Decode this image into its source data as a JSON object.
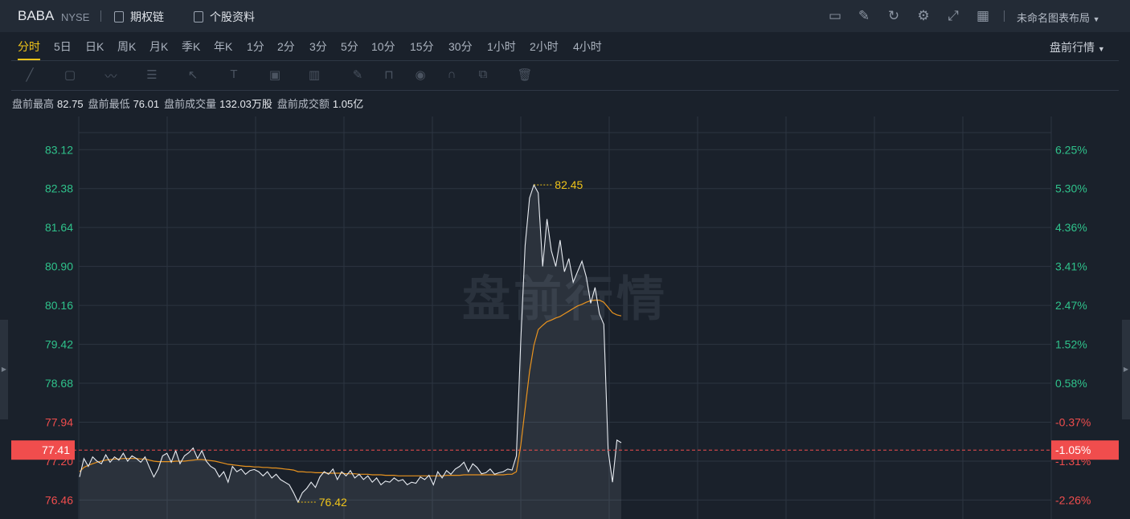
{
  "header": {
    "symbol": "BABA",
    "exchange": "NYSE",
    "options_chain": "期权链",
    "stock_profile": "个股资料",
    "layout_name": "未命名图表布局",
    "icons": [
      "monitor-icon",
      "pencil-icon",
      "refresh-icon",
      "gear-icon",
      "fullscreen-icon",
      "grid-icon"
    ]
  },
  "periods": [
    "分时",
    "5日",
    "日K",
    "周K",
    "月K",
    "季K",
    "年K",
    "1分",
    "2分",
    "3分",
    "5分",
    "10分",
    "15分",
    "30分",
    "1小时",
    "2小时",
    "4小时"
  ],
  "active_period": "分时",
  "session_mode": "盘前行情",
  "stats": [
    {
      "label": "盘前最高",
      "value": "82.75"
    },
    {
      "label": "盘前最低",
      "value": "76.01"
    },
    {
      "label": "盘前成交量",
      "value": "132.03万股"
    },
    {
      "label": "盘前成交额",
      "value": "1.05亿"
    }
  ],
  "colors": {
    "up": "#2fc28b",
    "down": "#f04d4d",
    "accent": "#f0c419",
    "price_line": "#e8ecf2",
    "avg_line": "#e8931f"
  },
  "chart_data": {
    "type": "line",
    "watermark": "盘前行情",
    "ylim": [
      76.1,
      83.75
    ],
    "y_ticks_left": [
      "83.12",
      "82.38",
      "81.64",
      "80.90",
      "80.16",
      "79.42",
      "78.68",
      "77.94",
      "77.20",
      "76.46"
    ],
    "y_ticks_right": [
      "6.25%",
      "5.30%",
      "4.36%",
      "3.41%",
      "2.47%",
      "1.52%",
      "0.58%",
      "-0.37%",
      "-1.31%",
      "-2.26%"
    ],
    "current_price": "77.41",
    "current_change": "-1.05%",
    "max_label": "82.45",
    "min_label": "76.42",
    "series": [
      {
        "name": "price",
        "values": [
          76.9,
          77.25,
          77.1,
          77.28,
          77.2,
          77.15,
          77.32,
          77.18,
          77.28,
          77.22,
          77.35,
          77.2,
          77.3,
          77.25,
          77.18,
          77.28,
          77.08,
          76.9,
          77.05,
          77.3,
          77.35,
          77.18,
          77.4,
          77.15,
          77.3,
          77.36,
          77.45,
          77.25,
          77.4,
          77.2,
          77.1,
          77.05,
          76.9,
          77.0,
          76.8,
          77.1,
          77.0,
          77.05,
          76.95,
          77.02,
          77.04,
          77.0,
          76.92,
          77.0,
          76.88,
          76.95,
          76.85,
          76.8,
          76.75,
          76.6,
          76.42,
          76.6,
          76.68,
          76.8,
          76.7,
          76.9,
          77.0,
          76.95,
          77.05,
          76.85,
          77.0,
          76.92,
          77.02,
          76.88,
          76.95,
          76.85,
          76.92,
          76.8,
          76.88,
          76.75,
          76.82,
          76.8,
          76.88,
          76.82,
          76.85,
          76.75,
          76.8,
          76.78,
          76.9,
          76.85,
          76.93,
          76.75,
          77.0,
          76.88,
          77.02,
          76.95,
          77.05,
          77.1,
          77.18,
          77.0,
          77.15,
          77.08,
          76.96,
          76.98,
          77.05,
          76.95,
          76.98,
          77.0,
          77.05,
          77.03,
          77.3,
          79.5,
          81.3,
          82.2,
          82.45,
          82.3,
          80.9,
          81.8,
          81.2,
          80.9,
          81.4,
          80.8,
          81.05,
          80.6,
          80.8,
          81.0,
          80.7,
          80.2,
          80.5,
          80.0,
          79.8,
          77.4,
          76.8,
          77.6,
          77.55
        ]
      },
      {
        "name": "avg",
        "values": [
          77.0,
          77.08,
          77.12,
          77.15,
          77.18,
          77.2,
          77.22,
          77.23,
          77.24,
          77.24,
          77.25,
          77.25,
          77.25,
          77.25,
          77.24,
          77.24,
          77.22,
          77.2,
          77.19,
          77.19,
          77.19,
          77.19,
          77.2,
          77.2,
          77.2,
          77.21,
          77.22,
          77.23,
          77.23,
          77.22,
          77.21,
          77.2,
          77.18,
          77.16,
          77.14,
          77.13,
          77.12,
          77.11,
          77.1,
          77.1,
          77.09,
          77.09,
          77.08,
          77.08,
          77.07,
          77.07,
          77.06,
          77.05,
          77.04,
          77.03,
          77.0,
          77.0,
          76.99,
          76.99,
          76.98,
          76.98,
          76.98,
          76.97,
          76.97,
          76.97,
          76.97,
          76.96,
          76.96,
          76.96,
          76.95,
          76.95,
          76.95,
          76.94,
          76.94,
          76.94,
          76.93,
          76.93,
          76.93,
          76.92,
          76.92,
          76.92,
          76.92,
          76.92,
          76.92,
          76.92,
          76.92,
          76.92,
          76.92,
          76.92,
          76.93,
          76.93,
          76.93,
          76.93,
          76.94,
          76.94,
          76.94,
          76.94,
          76.94,
          76.94,
          76.94,
          76.94,
          76.94,
          76.94,
          76.95,
          76.95,
          77.0,
          77.5,
          78.2,
          78.9,
          79.4,
          79.7,
          79.78,
          79.85,
          79.88,
          79.92,
          79.95,
          80.0,
          80.05,
          80.1,
          80.15,
          80.18,
          80.22,
          80.25,
          80.26,
          80.26,
          80.22,
          80.12,
          80.02,
          79.98,
          79.96
        ]
      }
    ]
  }
}
